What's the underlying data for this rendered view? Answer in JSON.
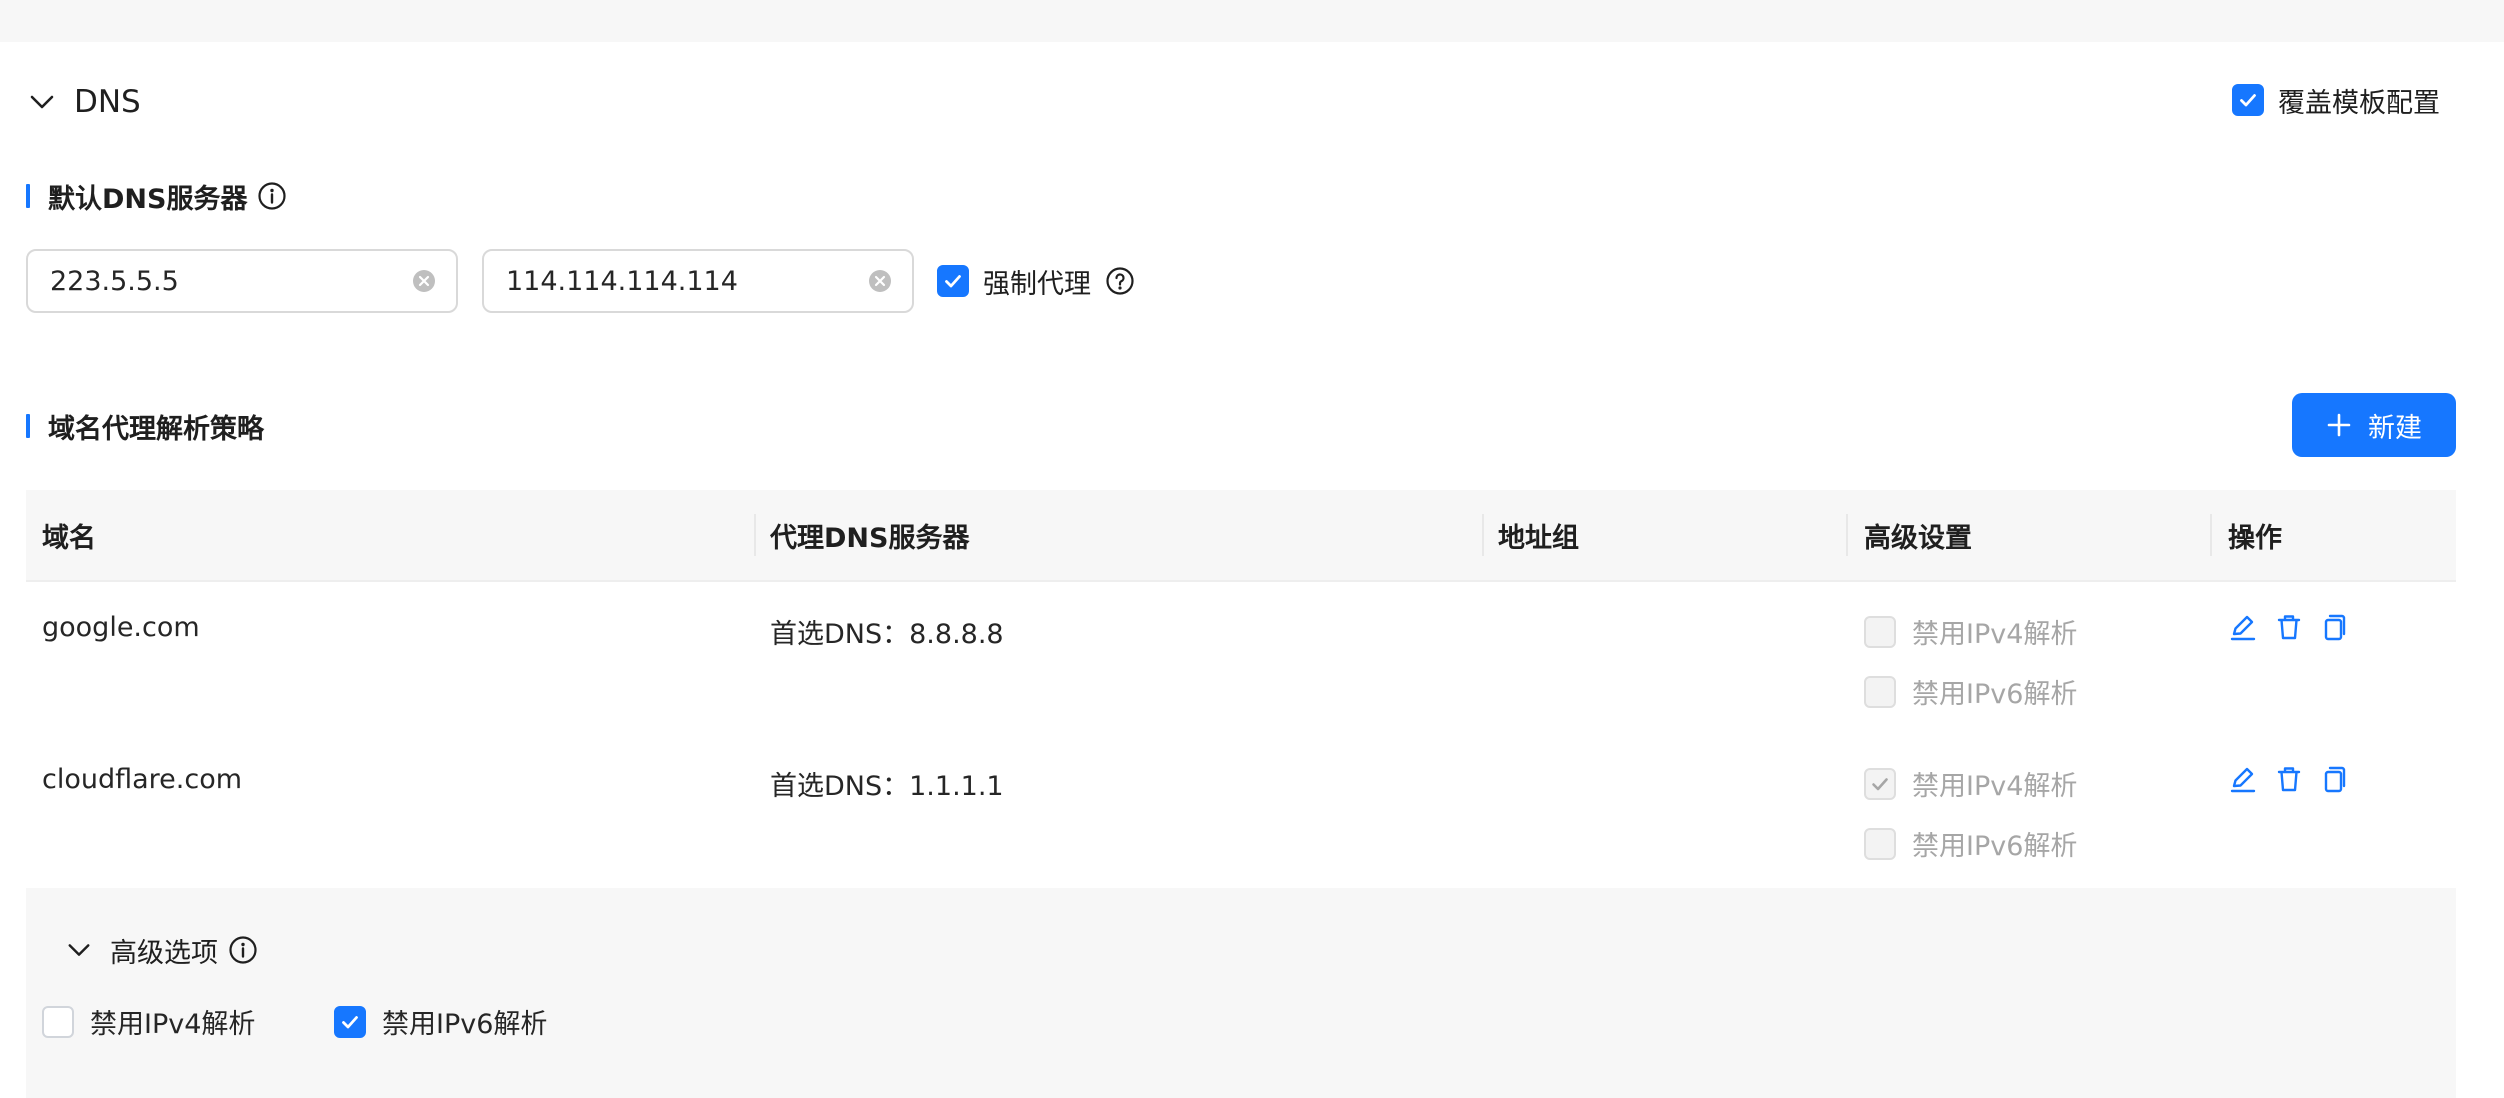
{
  "section": {
    "title": "DNS",
    "override_label": "覆盖模板配置",
    "override_checked": true
  },
  "default_dns": {
    "heading": "默认DNS服务器",
    "inputs": [
      "223.5.5.5",
      "114.114.114.114"
    ],
    "force_proxy_label": "强制代理",
    "force_proxy_checked": true
  },
  "policy": {
    "heading": "域名代理解析策略",
    "new_button_label": "新建",
    "columns": [
      "域名",
      "代理DNS服务器",
      "地址组",
      "高级设置",
      "操作"
    ],
    "rows": [
      {
        "domain": "google.com",
        "dns": "首选DNS：8.8.8.8",
        "group": "",
        "ipv4_label": "禁用IPv4解析",
        "ipv4_checked": false,
        "ipv6_label": "禁用IPv6解析",
        "ipv6_checked": false
      },
      {
        "domain": "cloudflare.com",
        "dns": "首选DNS：1.1.1.1",
        "group": "",
        "ipv4_label": "禁用IPv4解析",
        "ipv4_checked": true,
        "ipv6_label": "禁用IPv6解析",
        "ipv6_checked": false
      }
    ]
  },
  "advanced": {
    "title": "高级选项",
    "ipv4_label": "禁用IPv4解析",
    "ipv4_checked": false,
    "ipv6_label": "禁用IPv6解析",
    "ipv6_checked": true
  },
  "colors": {
    "accent": "#1677ff",
    "disabled_text": "#a6a6a6",
    "panel_bg": "#f7f7f7"
  },
  "icons": [
    "chevron-down-icon",
    "info-icon",
    "clear-icon",
    "check-icon",
    "help-icon",
    "plus-icon",
    "edit-icon",
    "delete-icon",
    "copy-icon"
  ]
}
